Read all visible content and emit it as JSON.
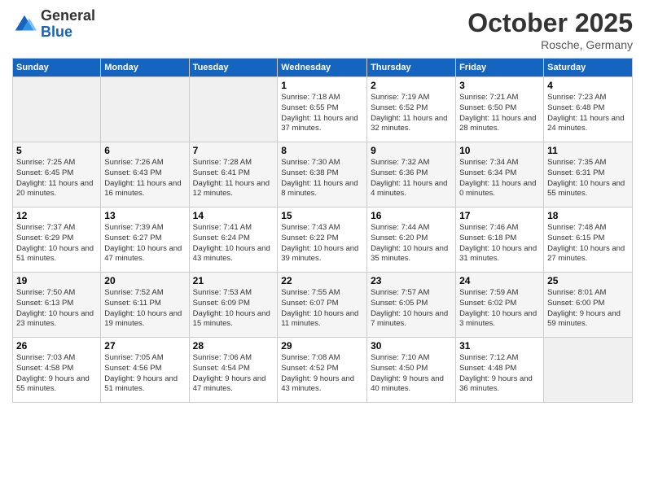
{
  "logo": {
    "general": "General",
    "blue": "Blue"
  },
  "title": "October 2025",
  "subtitle": "Rosche, Germany",
  "days_of_week": [
    "Sunday",
    "Monday",
    "Tuesday",
    "Wednesday",
    "Thursday",
    "Friday",
    "Saturday"
  ],
  "weeks": [
    [
      {
        "day": "",
        "empty": true
      },
      {
        "day": "",
        "empty": true
      },
      {
        "day": "",
        "empty": true
      },
      {
        "day": "1",
        "sunrise": "7:18 AM",
        "sunset": "6:55 PM",
        "daylight": "11 hours and 37 minutes."
      },
      {
        "day": "2",
        "sunrise": "7:19 AM",
        "sunset": "6:52 PM",
        "daylight": "11 hours and 32 minutes."
      },
      {
        "day": "3",
        "sunrise": "7:21 AM",
        "sunset": "6:50 PM",
        "daylight": "11 hours and 28 minutes."
      },
      {
        "day": "4",
        "sunrise": "7:23 AM",
        "sunset": "6:48 PM",
        "daylight": "11 hours and 24 minutes."
      }
    ],
    [
      {
        "day": "5",
        "sunrise": "7:25 AM",
        "sunset": "6:45 PM",
        "daylight": "11 hours and 20 minutes."
      },
      {
        "day": "6",
        "sunrise": "7:26 AM",
        "sunset": "6:43 PM",
        "daylight": "11 hours and 16 minutes."
      },
      {
        "day": "7",
        "sunrise": "7:28 AM",
        "sunset": "6:41 PM",
        "daylight": "11 hours and 12 minutes."
      },
      {
        "day": "8",
        "sunrise": "7:30 AM",
        "sunset": "6:38 PM",
        "daylight": "11 hours and 8 minutes."
      },
      {
        "day": "9",
        "sunrise": "7:32 AM",
        "sunset": "6:36 PM",
        "daylight": "11 hours and 4 minutes."
      },
      {
        "day": "10",
        "sunrise": "7:34 AM",
        "sunset": "6:34 PM",
        "daylight": "11 hours and 0 minutes."
      },
      {
        "day": "11",
        "sunrise": "7:35 AM",
        "sunset": "6:31 PM",
        "daylight": "10 hours and 55 minutes."
      }
    ],
    [
      {
        "day": "12",
        "sunrise": "7:37 AM",
        "sunset": "6:29 PM",
        "daylight": "10 hours and 51 minutes."
      },
      {
        "day": "13",
        "sunrise": "7:39 AM",
        "sunset": "6:27 PM",
        "daylight": "10 hours and 47 minutes."
      },
      {
        "day": "14",
        "sunrise": "7:41 AM",
        "sunset": "6:24 PM",
        "daylight": "10 hours and 43 minutes."
      },
      {
        "day": "15",
        "sunrise": "7:43 AM",
        "sunset": "6:22 PM",
        "daylight": "10 hours and 39 minutes."
      },
      {
        "day": "16",
        "sunrise": "7:44 AM",
        "sunset": "6:20 PM",
        "daylight": "10 hours and 35 minutes."
      },
      {
        "day": "17",
        "sunrise": "7:46 AM",
        "sunset": "6:18 PM",
        "daylight": "10 hours and 31 minutes."
      },
      {
        "day": "18",
        "sunrise": "7:48 AM",
        "sunset": "6:15 PM",
        "daylight": "10 hours and 27 minutes."
      }
    ],
    [
      {
        "day": "19",
        "sunrise": "7:50 AM",
        "sunset": "6:13 PM",
        "daylight": "10 hours and 23 minutes."
      },
      {
        "day": "20",
        "sunrise": "7:52 AM",
        "sunset": "6:11 PM",
        "daylight": "10 hours and 19 minutes."
      },
      {
        "day": "21",
        "sunrise": "7:53 AM",
        "sunset": "6:09 PM",
        "daylight": "10 hours and 15 minutes."
      },
      {
        "day": "22",
        "sunrise": "7:55 AM",
        "sunset": "6:07 PM",
        "daylight": "10 hours and 11 minutes."
      },
      {
        "day": "23",
        "sunrise": "7:57 AM",
        "sunset": "6:05 PM",
        "daylight": "10 hours and 7 minutes."
      },
      {
        "day": "24",
        "sunrise": "7:59 AM",
        "sunset": "6:02 PM",
        "daylight": "10 hours and 3 minutes."
      },
      {
        "day": "25",
        "sunrise": "8:01 AM",
        "sunset": "6:00 PM",
        "daylight": "9 hours and 59 minutes."
      }
    ],
    [
      {
        "day": "26",
        "sunrise": "7:03 AM",
        "sunset": "4:58 PM",
        "daylight": "9 hours and 55 minutes."
      },
      {
        "day": "27",
        "sunrise": "7:05 AM",
        "sunset": "4:56 PM",
        "daylight": "9 hours and 51 minutes."
      },
      {
        "day": "28",
        "sunrise": "7:06 AM",
        "sunset": "4:54 PM",
        "daylight": "9 hours and 47 minutes."
      },
      {
        "day": "29",
        "sunrise": "7:08 AM",
        "sunset": "4:52 PM",
        "daylight": "9 hours and 43 minutes."
      },
      {
        "day": "30",
        "sunrise": "7:10 AM",
        "sunset": "4:50 PM",
        "daylight": "9 hours and 40 minutes."
      },
      {
        "day": "31",
        "sunrise": "7:12 AM",
        "sunset": "4:48 PM",
        "daylight": "9 hours and 36 minutes."
      },
      {
        "day": "",
        "empty": true
      }
    ]
  ]
}
